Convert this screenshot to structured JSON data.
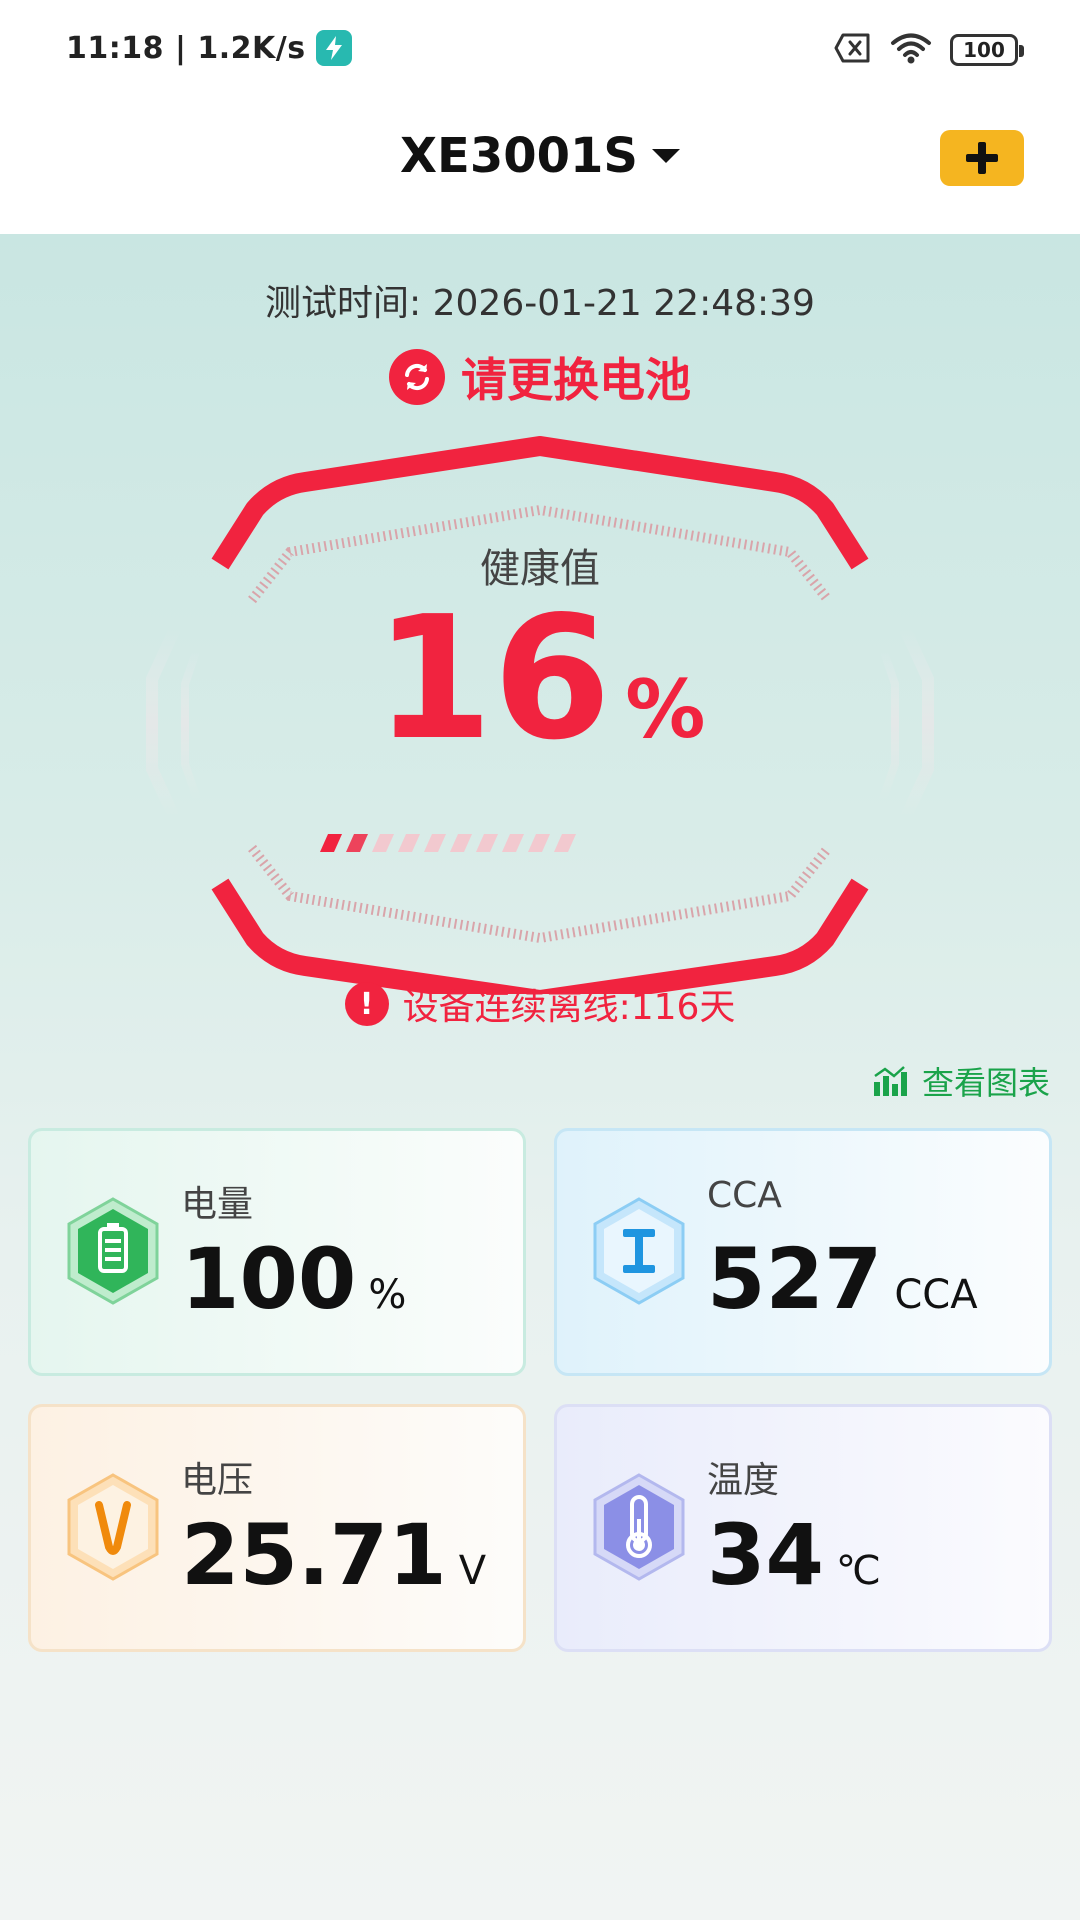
{
  "status_bar": {
    "time": "11:18 | 1.2K/s",
    "battery": "100"
  },
  "header": {
    "device_name": "XE3001S"
  },
  "test": {
    "time_label": "测试时间: 2026-01-21 22:48:39",
    "alert": "请更换电池"
  },
  "health": {
    "label": "健康值",
    "value": "16",
    "unit": "%",
    "level_fraction": 0.16
  },
  "offline": {
    "text": "设备连续离线:116天"
  },
  "chart_link": {
    "label": "查看图表"
  },
  "cards": [
    {
      "label": "电量",
      "value": "100",
      "unit": "%",
      "icon": "battery-icon"
    },
    {
      "label": "CCA",
      "value": "527",
      "unit": "CCA",
      "icon": "cca-icon"
    },
    {
      "label": "电压",
      "value": "25.71",
      "unit": "V",
      "icon": "voltage-icon"
    },
    {
      "label": "温度",
      "value": "34",
      "unit": "℃",
      "icon": "thermometer-icon"
    }
  ],
  "colors": {
    "alert_red": "#f1233f",
    "accent_yellow": "#f5b520",
    "chart_green": "#1aa34a"
  }
}
